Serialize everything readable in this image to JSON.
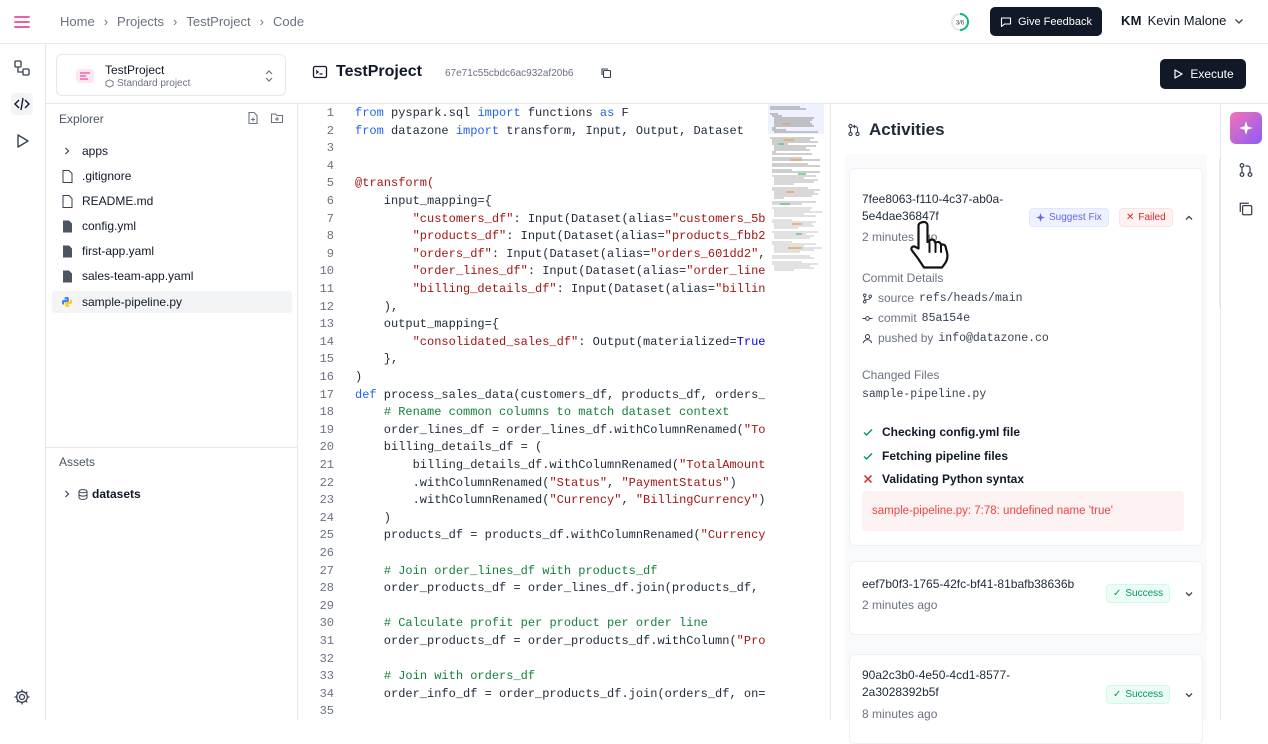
{
  "header": {
    "breadcrumb": [
      "Home",
      "Projects",
      "TestProject",
      "Code"
    ],
    "progress_label": "3/6",
    "feedback_label": "Give Feedback",
    "user_initials": "KM",
    "user_name": "Kevin Malone"
  },
  "project": {
    "name": "TestProject",
    "type": "Standard project"
  },
  "file": {
    "title": "TestProject",
    "hash": "67e71c55cbdc6ac932af20b6",
    "execute_label": "Execute"
  },
  "explorer": {
    "title": "Explorer",
    "items": [
      {
        "label": "apps",
        "icon": "chevron-right-icon"
      },
      {
        "label": ".gitignore",
        "icon": "file-icon"
      },
      {
        "label": "README.md",
        "icon": "file-icon"
      },
      {
        "label": "config.yml",
        "icon": "yaml-file-icon"
      },
      {
        "label": "first-app.yaml",
        "icon": "yaml-file-icon"
      },
      {
        "label": "sales-team-app.yaml",
        "icon": "yaml-file-icon"
      },
      {
        "label": "sample-pipeline.py",
        "icon": "python-file-icon"
      }
    ],
    "assets_title": "Assets",
    "assets_items": [
      {
        "label": "datasets",
        "icon": "database-icon"
      }
    ]
  },
  "editor": {
    "line_numbers": [
      "1",
      "2",
      "3",
      "4",
      "5",
      "6",
      "7",
      "8",
      "9",
      "10",
      "11",
      "12",
      "13",
      "14",
      "15",
      "16",
      "17",
      "18",
      "19",
      "20",
      "21",
      "22",
      "23",
      "24",
      "25",
      "26",
      "27",
      "28",
      "29",
      "30",
      "31",
      "32",
      "33",
      "34",
      "35"
    ]
  },
  "activities": {
    "title": "Activities",
    "items": [
      {
        "id": "7fee8063-f110-4c37-ab0a-5e4dae36847f",
        "time": "2 minutes ago",
        "suggest_label": "Suggest Fix",
        "status": "Failed",
        "commit_details_label": "Commit Details",
        "source_label": "source",
        "source": "refs/heads/main",
        "commit_label": "commit",
        "commit": "85a154e",
        "pushed_label": "pushed by",
        "pushed_by": "info@datazone.co",
        "changed_files_label": "Changed Files",
        "changed_file": "sample-pipeline.py",
        "steps": [
          {
            "label": "Checking config.yml file",
            "state": "done"
          },
          {
            "label": "Fetching pipeline files",
            "state": "done"
          },
          {
            "label": "Validating Python syntax",
            "state": "error"
          }
        ],
        "error": "sample-pipeline.py: 7:78: undefined name 'true'"
      },
      {
        "id": "eef7b0f3-1765-42fc-bf41-81bafb38636b",
        "time": "2 minutes ago",
        "status": "Success"
      },
      {
        "id": "90a2c3b0-4e50-4cd1-8577-2a3028392b5f",
        "time": "8 minutes ago",
        "status": "Success"
      }
    ]
  },
  "colors": {
    "accent": "#111827",
    "success": "#059669",
    "error": "#dc2626",
    "brand_pink": "#ec4899"
  }
}
